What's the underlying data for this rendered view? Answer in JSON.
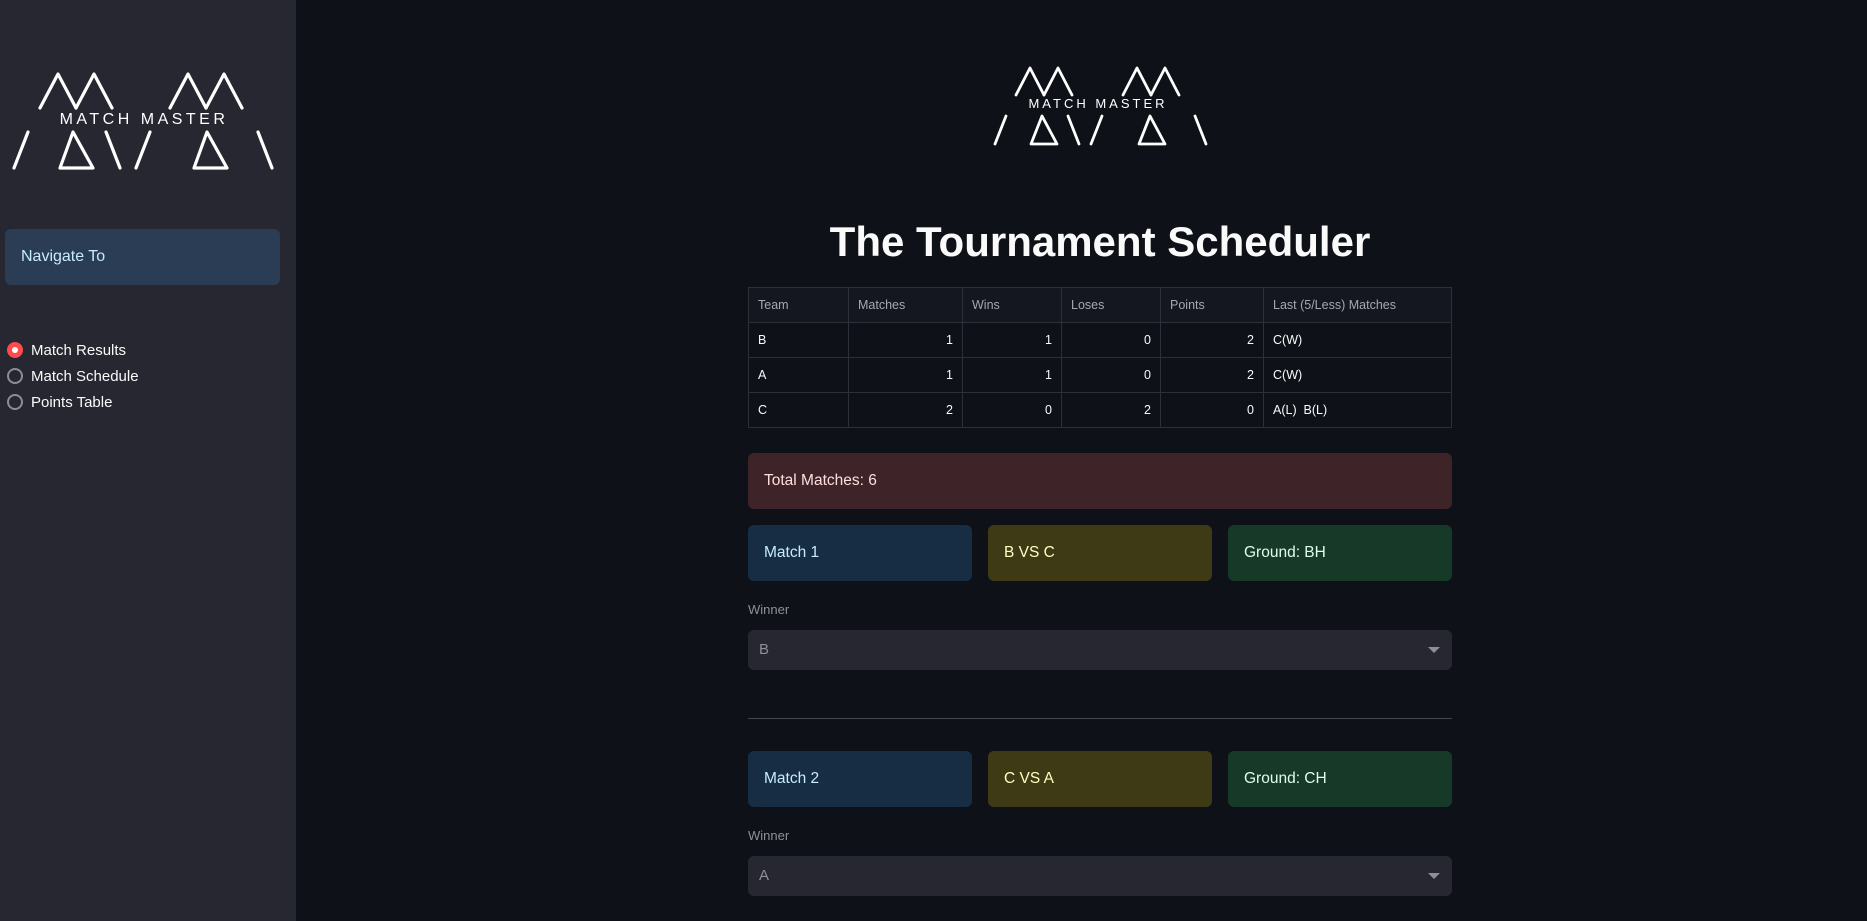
{
  "sidebar": {
    "logo_text": "MATCH MASTER",
    "nav_title": "Navigate To",
    "options": [
      {
        "label": "Match Results",
        "selected": true
      },
      {
        "label": "Match Schedule",
        "selected": false
      },
      {
        "label": "Points Table",
        "selected": false
      }
    ],
    "accent_color": "#ff4b4b"
  },
  "main": {
    "logo_text": "MATCH MASTER",
    "title": "The Tournament Scheduler",
    "table": {
      "columns": [
        "Team",
        "Matches",
        "Wins",
        "Loses",
        "Points",
        "Last (5/Less) Matches"
      ],
      "rows": [
        [
          "B",
          "1",
          "1",
          "0",
          "2",
          "C(W)"
        ],
        [
          "A",
          "1",
          "1",
          "0",
          "2",
          "C(W)"
        ],
        [
          "C",
          "2",
          "0",
          "2",
          "0",
          "A(L)  B(L)"
        ]
      ]
    },
    "total_matches": "Total Matches: 6",
    "matches": [
      {
        "match": "Match 1",
        "teams": "B VS C",
        "ground": "Ground: BH",
        "winner_label": "Winner",
        "winner_value": "B"
      },
      {
        "match": "Match 2",
        "teams": "C VS A",
        "ground": "Ground: CH",
        "winner_label": "Winner",
        "winner_value": "A"
      }
    ]
  }
}
